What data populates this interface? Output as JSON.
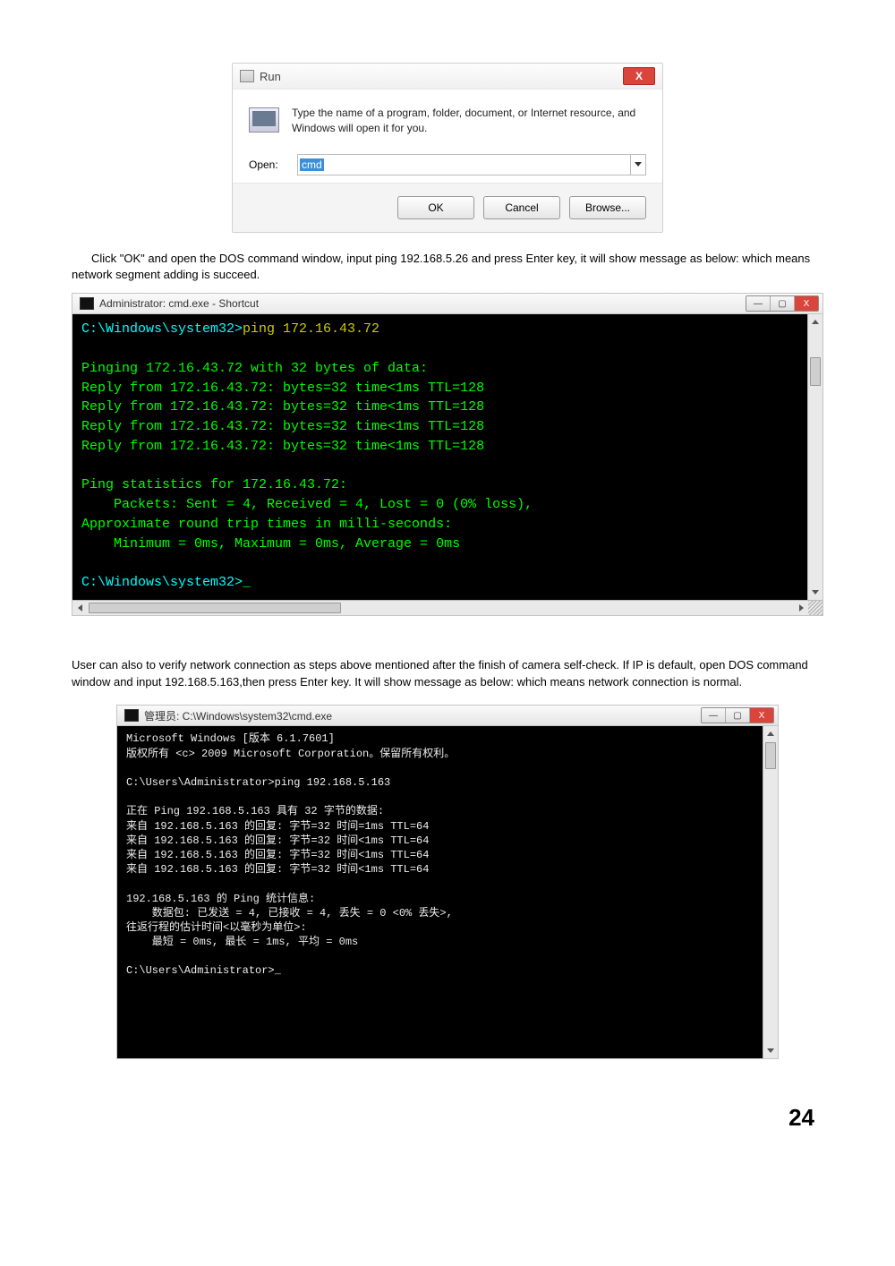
{
  "run_dialog": {
    "title": "Run",
    "close_x": "X",
    "description": "Type the name of a program, folder, document, or Internet resource, and Windows will open it for you.",
    "open_label": "Open:",
    "value": "cmd",
    "ok": "OK",
    "cancel": "Cancel",
    "browse": "Browse..."
  },
  "para1": "Click \"OK\" and open the DOS command window, input ping 192.168.5.26 and press Enter key, it will show message as below: which means network segment adding is succeed.",
  "cmd1": {
    "title": "Administrator: cmd.exe - Shortcut",
    "min": "—",
    "max": "▢",
    "close": "X",
    "lines_html": "<span class=\"prompt\">C:\\Windows\\system32&gt;</span><span class=\"yellow\">ping 172.16.43.72</span>\n\nPinging 172.16.43.72 with 32 bytes of data:\nReply from 172.16.43.72: bytes=32 time&lt;1ms TTL=128\nReply from 172.16.43.72: bytes=32 time&lt;1ms TTL=128\nReply from 172.16.43.72: bytes=32 time&lt;1ms TTL=128\nReply from 172.16.43.72: bytes=32 time&lt;1ms TTL=128\n\nPing statistics for 172.16.43.72:\n    Packets: Sent = 4, Received = 4, Lost = 0 (0% loss),\nApproximate round trip times in milli-seconds:\n    Minimum = 0ms, Maximum = 0ms, Average = 0ms\n\n<span class=\"prompt\">C:\\Windows\\system32&gt;</span>_"
  },
  "para2": "User can also to verify network connection as steps above mentioned after the finish of camera self-check. If IP is default, open DOS command window and input 192.168.5.163,then press Enter key. It will show message as below: which means network connection is normal.",
  "cmd2": {
    "title": "管理员: C:\\Windows\\system32\\cmd.exe",
    "min": "—",
    "max": "▢",
    "close": "X",
    "lines_html": "Microsoft Windows [版本 6.1.7601]\n版权所有 &lt;c&gt; 2009 Microsoft Corporation。保留所有权利。\n\nC:\\Users\\Administrator&gt;ping 192.168.5.163\n\n正在 Ping 192.168.5.163 具有 32 字节的数据:\n来自 192.168.5.163 的回复: 字节=32 时间=1ms TTL=64\n来自 192.168.5.163 的回复: 字节=32 时间&lt;1ms TTL=64\n来自 192.168.5.163 的回复: 字节=32 时间&lt;1ms TTL=64\n来自 192.168.5.163 的回复: 字节=32 时间&lt;1ms TTL=64\n\n192.168.5.163 的 Ping 统计信息:\n    数据包: 已发送 = 4, 已接收 = 4, 丢失 = 0 &lt;0% 丢失&gt;,\n往返行程的估计时间&lt;以毫秒为单位&gt;:\n    最短 = 0ms, 最长 = 1ms, 平均 = 0ms\n\nC:\\Users\\Administrator&gt;_\n\n\n\n\n\n"
  },
  "page_number": "24"
}
